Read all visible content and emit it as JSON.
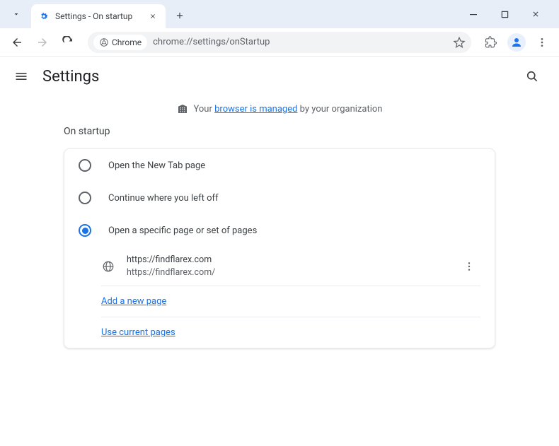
{
  "window": {
    "tab_title": "Settings - On startup"
  },
  "toolbar": {
    "chrome_chip": "Chrome",
    "url": "chrome://settings/onStartup"
  },
  "header": {
    "title": "Settings"
  },
  "banner": {
    "prefix": "Your ",
    "link": "browser is managed",
    "suffix": " by your organization"
  },
  "section": {
    "title": "On startup"
  },
  "options": {
    "new_tab": "Open the New Tab page",
    "continue": "Continue where you left off",
    "specific": "Open a specific page or set of pages"
  },
  "page": {
    "title": "https://findflarex.com",
    "url": "https://findflarex.com/"
  },
  "links": {
    "add": "Add a new page",
    "use_current": "Use current pages"
  }
}
